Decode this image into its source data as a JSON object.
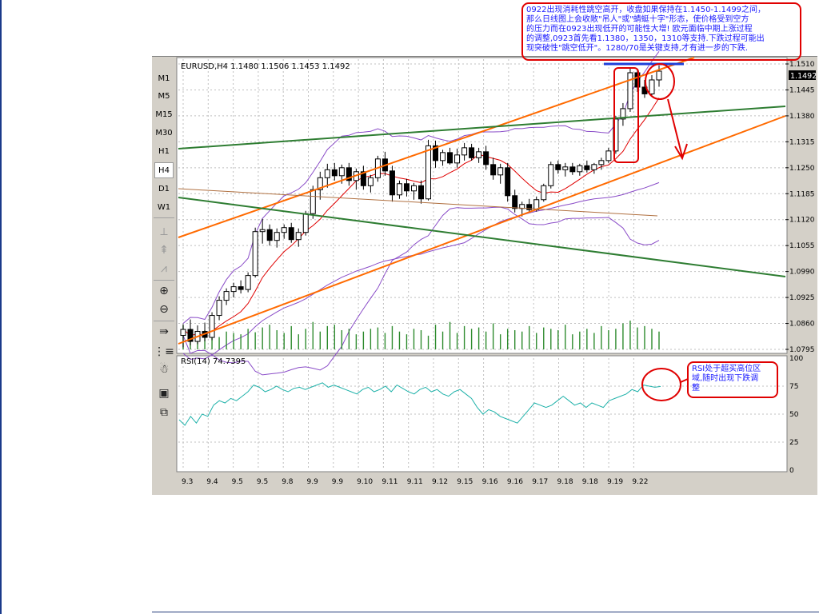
{
  "sidebar": {
    "timeframes": [
      "M1",
      "M5",
      "M15",
      "M30",
      "H1",
      "H4",
      "D1",
      "W1"
    ],
    "active_timeframe": "H4"
  },
  "chart_data": {
    "type": "candlestick",
    "symbol_header": "EURUSD,H4  1.1480 1.1506 1.1453 1.1492",
    "current_price_label": "1.1492",
    "price_ticks": [
      "1.1510",
      "1.1445",
      "1.1380",
      "1.1315",
      "1.1250",
      "1.1185",
      "1.1120",
      "1.1055",
      "1.0990",
      "1.0925",
      "1.0860",
      "1.0795"
    ],
    "ylim": [
      1.0795,
      1.151
    ],
    "x_labels": [
      "9.3",
      "9.4",
      "9.5",
      "9.5",
      "9.8",
      "9.9",
      "9.9",
      "9.10",
      "9.11",
      "9.11",
      "9.12",
      "9.15",
      "9.16",
      "9.16",
      "9.17",
      "9.18",
      "9.18",
      "9.19",
      "9.22"
    ],
    "candles": [
      {
        "o": 1.083,
        "h": 1.0858,
        "l": 1.08,
        "c": 1.0845
      },
      {
        "o": 1.0845,
        "h": 1.087,
        "l": 1.0805,
        "c": 1.0815
      },
      {
        "o": 1.0815,
        "h": 1.0855,
        "l": 1.0808,
        "c": 1.084
      },
      {
        "o": 1.084,
        "h": 1.0862,
        "l": 1.0815,
        "c": 1.0825
      },
      {
        "o": 1.0825,
        "h": 1.0888,
        "l": 1.0818,
        "c": 1.088
      },
      {
        "o": 1.088,
        "h": 1.0928,
        "l": 1.0868,
        "c": 1.0918
      },
      {
        "o": 1.0918,
        "h": 1.0948,
        "l": 1.0906,
        "c": 1.094
      },
      {
        "o": 1.094,
        "h": 1.0962,
        "l": 1.0925,
        "c": 1.0952
      },
      {
        "o": 1.0952,
        "h": 1.0968,
        "l": 1.0935,
        "c": 1.0945
      },
      {
        "o": 1.0945,
        "h": 1.0988,
        "l": 1.0938,
        "c": 1.098
      },
      {
        "o": 1.098,
        "h": 1.11,
        "l": 1.0975,
        "c": 1.109
      },
      {
        "o": 1.109,
        "h": 1.1122,
        "l": 1.106,
        "c": 1.1095
      },
      {
        "o": 1.1095,
        "h": 1.1108,
        "l": 1.1055,
        "c": 1.1068
      },
      {
        "o": 1.1068,
        "h": 1.1098,
        "l": 1.105,
        "c": 1.1088
      },
      {
        "o": 1.1088,
        "h": 1.1108,
        "l": 1.1072,
        "c": 1.11
      },
      {
        "o": 1.11,
        "h": 1.1112,
        "l": 1.1062,
        "c": 1.107
      },
      {
        "o": 1.107,
        "h": 1.1098,
        "l": 1.1052,
        "c": 1.1088
      },
      {
        "o": 1.1088,
        "h": 1.1142,
        "l": 1.108,
        "c": 1.1135
      },
      {
        "o": 1.1135,
        "h": 1.1205,
        "l": 1.1122,
        "c": 1.1195
      },
      {
        "o": 1.1195,
        "h": 1.124,
        "l": 1.117,
        "c": 1.1225
      },
      {
        "o": 1.1225,
        "h": 1.126,
        "l": 1.12,
        "c": 1.1245
      },
      {
        "o": 1.1245,
        "h": 1.1262,
        "l": 1.1218,
        "c": 1.123
      },
      {
        "o": 1.123,
        "h": 1.1258,
        "l": 1.121,
        "c": 1.125
      },
      {
        "o": 1.125,
        "h": 1.1262,
        "l": 1.1205,
        "c": 1.1218
      },
      {
        "o": 1.1218,
        "h": 1.1248,
        "l": 1.1195,
        "c": 1.124
      },
      {
        "o": 1.124,
        "h": 1.1255,
        "l": 1.1195,
        "c": 1.1205
      },
      {
        "o": 1.1205,
        "h": 1.1232,
        "l": 1.1188,
        "c": 1.1225
      },
      {
        "o": 1.1225,
        "h": 1.128,
        "l": 1.1215,
        "c": 1.1272
      },
      {
        "o": 1.1272,
        "h": 1.129,
        "l": 1.123,
        "c": 1.1242
      },
      {
        "o": 1.1242,
        "h": 1.1255,
        "l": 1.1165,
        "c": 1.1182
      },
      {
        "o": 1.1182,
        "h": 1.1218,
        "l": 1.1172,
        "c": 1.121
      },
      {
        "o": 1.121,
        "h": 1.1222,
        "l": 1.1178,
        "c": 1.1192
      },
      {
        "o": 1.1192,
        "h": 1.1212,
        "l": 1.117,
        "c": 1.1205
      },
      {
        "o": 1.1205,
        "h": 1.1218,
        "l": 1.116,
        "c": 1.1172
      },
      {
        "o": 1.1172,
        "h": 1.132,
        "l": 1.1168,
        "c": 1.1305
      },
      {
        "o": 1.1305,
        "h": 1.1318,
        "l": 1.125,
        "c": 1.1268
      },
      {
        "o": 1.1268,
        "h": 1.1295,
        "l": 1.1255,
        "c": 1.1288
      },
      {
        "o": 1.1288,
        "h": 1.13,
        "l": 1.1258,
        "c": 1.1262
      },
      {
        "o": 1.1262,
        "h": 1.1298,
        "l": 1.125,
        "c": 1.1282
      },
      {
        "o": 1.1282,
        "h": 1.1312,
        "l": 1.1268,
        "c": 1.13
      },
      {
        "o": 1.13,
        "h": 1.131,
        "l": 1.1268,
        "c": 1.1275
      },
      {
        "o": 1.1275,
        "h": 1.13,
        "l": 1.1262,
        "c": 1.129
      },
      {
        "o": 1.129,
        "h": 1.1305,
        "l": 1.1245,
        "c": 1.1258
      },
      {
        "o": 1.1258,
        "h": 1.1275,
        "l": 1.122,
        "c": 1.1232
      },
      {
        "o": 1.1232,
        "h": 1.126,
        "l": 1.121,
        "c": 1.125
      },
      {
        "o": 1.125,
        "h": 1.1262,
        "l": 1.1165,
        "c": 1.118
      },
      {
        "o": 1.118,
        "h": 1.1195,
        "l": 1.1138,
        "c": 1.1148
      },
      {
        "o": 1.1148,
        "h": 1.1165,
        "l": 1.1128,
        "c": 1.1158
      },
      {
        "o": 1.1158,
        "h": 1.1172,
        "l": 1.1138,
        "c": 1.1145
      },
      {
        "o": 1.1145,
        "h": 1.1178,
        "l": 1.114,
        "c": 1.117
      },
      {
        "o": 1.117,
        "h": 1.121,
        "l": 1.1165,
        "c": 1.1205
      },
      {
        "o": 1.1205,
        "h": 1.1265,
        "l": 1.1198,
        "c": 1.1258
      },
      {
        "o": 1.1258,
        "h": 1.1268,
        "l": 1.1235,
        "c": 1.1245
      },
      {
        "o": 1.1245,
        "h": 1.1262,
        "l": 1.1228,
        "c": 1.1252
      },
      {
        "o": 1.1252,
        "h": 1.1262,
        "l": 1.1232,
        "c": 1.124
      },
      {
        "o": 1.124,
        "h": 1.126,
        "l": 1.123,
        "c": 1.1255
      },
      {
        "o": 1.1255,
        "h": 1.1268,
        "l": 1.1238,
        "c": 1.1245
      },
      {
        "o": 1.1245,
        "h": 1.1262,
        "l": 1.1235,
        "c": 1.1258
      },
      {
        "o": 1.1258,
        "h": 1.1275,
        "l": 1.1245,
        "c": 1.1268
      },
      {
        "o": 1.1268,
        "h": 1.13,
        "l": 1.1262,
        "c": 1.1292
      },
      {
        "o": 1.1292,
        "h": 1.138,
        "l": 1.1285,
        "c": 1.1372
      },
      {
        "o": 1.1372,
        "h": 1.1412,
        "l": 1.1355,
        "c": 1.1398
      },
      {
        "o": 1.1398,
        "h": 1.15,
        "l": 1.139,
        "c": 1.1488
      },
      {
        "o": 1.1488,
        "h": 1.1495,
        "l": 1.144,
        "c": 1.1452
      },
      {
        "o": 1.1452,
        "h": 1.147,
        "l": 1.1425,
        "c": 1.1435
      },
      {
        "o": 1.1435,
        "h": 1.1482,
        "l": 1.1428,
        "c": 1.147
      },
      {
        "o": 1.147,
        "h": 1.1506,
        "l": 1.1453,
        "c": 1.1492
      }
    ],
    "volume": [
      35,
      30,
      20,
      28,
      34,
      18,
      26,
      24,
      22,
      30,
      25,
      32,
      36,
      28,
      24,
      34,
      22,
      30,
      40,
      26,
      34,
      36,
      28,
      30,
      22,
      26,
      30,
      32,
      24,
      34,
      26,
      22,
      30,
      28,
      20,
      36,
      26,
      40,
      24,
      34,
      30,
      32,
      26,
      38,
      22,
      30,
      28,
      26,
      34,
      24,
      32,
      30,
      28,
      36,
      22,
      26,
      30,
      24,
      34,
      28,
      30,
      38,
      42,
      32,
      34,
      30,
      26
    ],
    "rsi": {
      "label": "RSI(14) 74.7395",
      "ticks": [
        "100",
        "75",
        "50",
        "25",
        "0"
      ],
      "ylim": [
        0,
        100
      ],
      "values": [
        45,
        40,
        48,
        42,
        50,
        48,
        58,
        62,
        60,
        64,
        62,
        66,
        70,
        76,
        74,
        70,
        72,
        75,
        72,
        70,
        73,
        74,
        72,
        74,
        76,
        78,
        74,
        76,
        74,
        72,
        70,
        68,
        72,
        74,
        70,
        72,
        75,
        70,
        76,
        73,
        70,
        68,
        72,
        74,
        70,
        72,
        68,
        66,
        70,
        72,
        68,
        64,
        56,
        50,
        54,
        52,
        48,
        46,
        44,
        42,
        48,
        54,
        60,
        58,
        56,
        58,
        62,
        66,
        62,
        58,
        60,
        56,
        60,
        58,
        56,
        62,
        64,
        66,
        68,
        72,
        70,
        76,
        75,
        74,
        74.7
      ]
    }
  },
  "annotations": {
    "main_text": "0922出现消耗性跳空高开，收盘如果保持在1.1450-1.1499之间，\n那么日线图上会收敞\"吊人\"或\"蜻蜓十字\"形态，使价格受到空方\n的压力而在0923出现低开的可能性大增! 欧元面临中期上涨过程\n的调整,0923首先看1.1380，1350，1310等支持.下跌过程可能出\n现突破性\"跳空低开\"。1280/70是关键支持,才有进一步的下跌.",
    "rsi_text": "RSI处于超买高位区\n域,随时出现下跌调\n整"
  },
  "colors": {
    "bull": "#ffffff",
    "bear": "#000000",
    "volume": "#2e8b2e",
    "channel": "#ff6a00",
    "trend_green": "#2e7d32",
    "ma_red": "#e00000",
    "band_purple": "#8a4cc8",
    "rsi_line": "#20b2aa",
    "annotation_red": "#e00000",
    "annotation_text": "#1a1aff",
    "blue_line": "#1f3fd8"
  }
}
